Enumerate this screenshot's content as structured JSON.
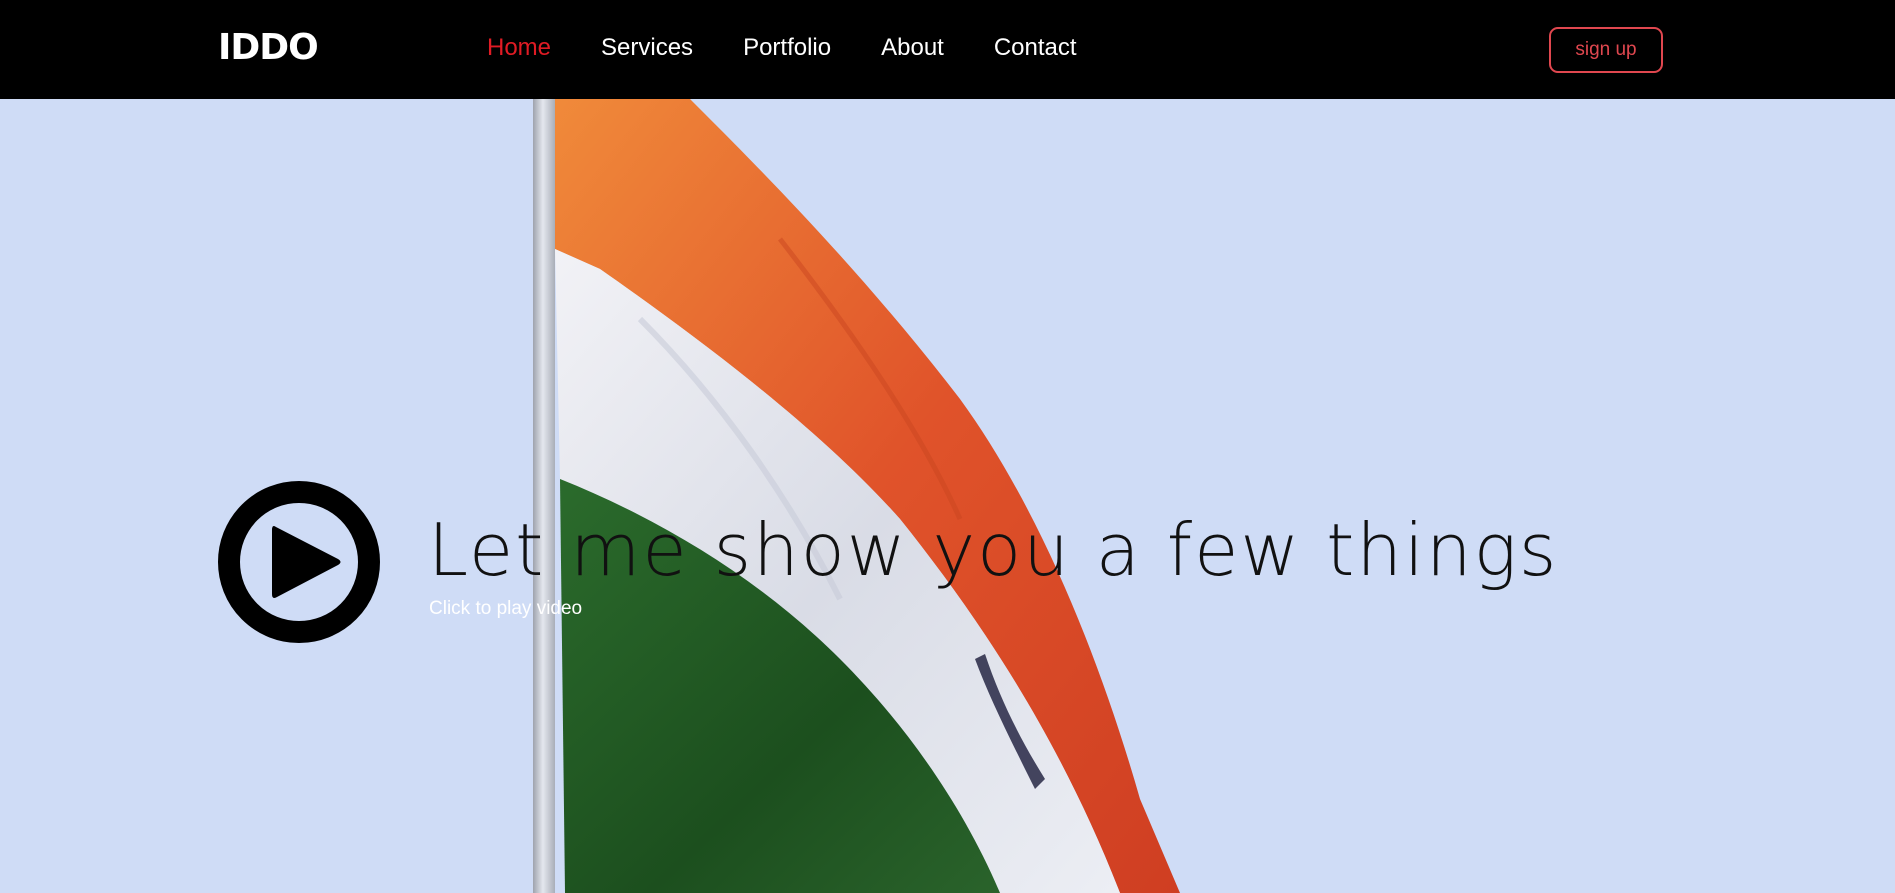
{
  "brand": {
    "logo_text": "IDDO"
  },
  "nav": {
    "items": [
      {
        "label": "Home",
        "active": true
      },
      {
        "label": "Services",
        "active": false
      },
      {
        "label": "Portfolio",
        "active": false
      },
      {
        "label": "About",
        "active": false
      },
      {
        "label": "Contact",
        "active": false
      }
    ],
    "signup_label": "sign up"
  },
  "hero": {
    "headline": "Let me show you a few things",
    "subtext": "Click to play video",
    "play_icon": "play-circle-icon"
  },
  "colors": {
    "nav_background": "#000000",
    "active_link": "#e01b24",
    "signup_accent": "#e0474f",
    "sky": "#cfdcf8",
    "flag_saffron": "#e8652a",
    "flag_white": "#e6e9f2",
    "flag_green": "#1f5a22"
  }
}
